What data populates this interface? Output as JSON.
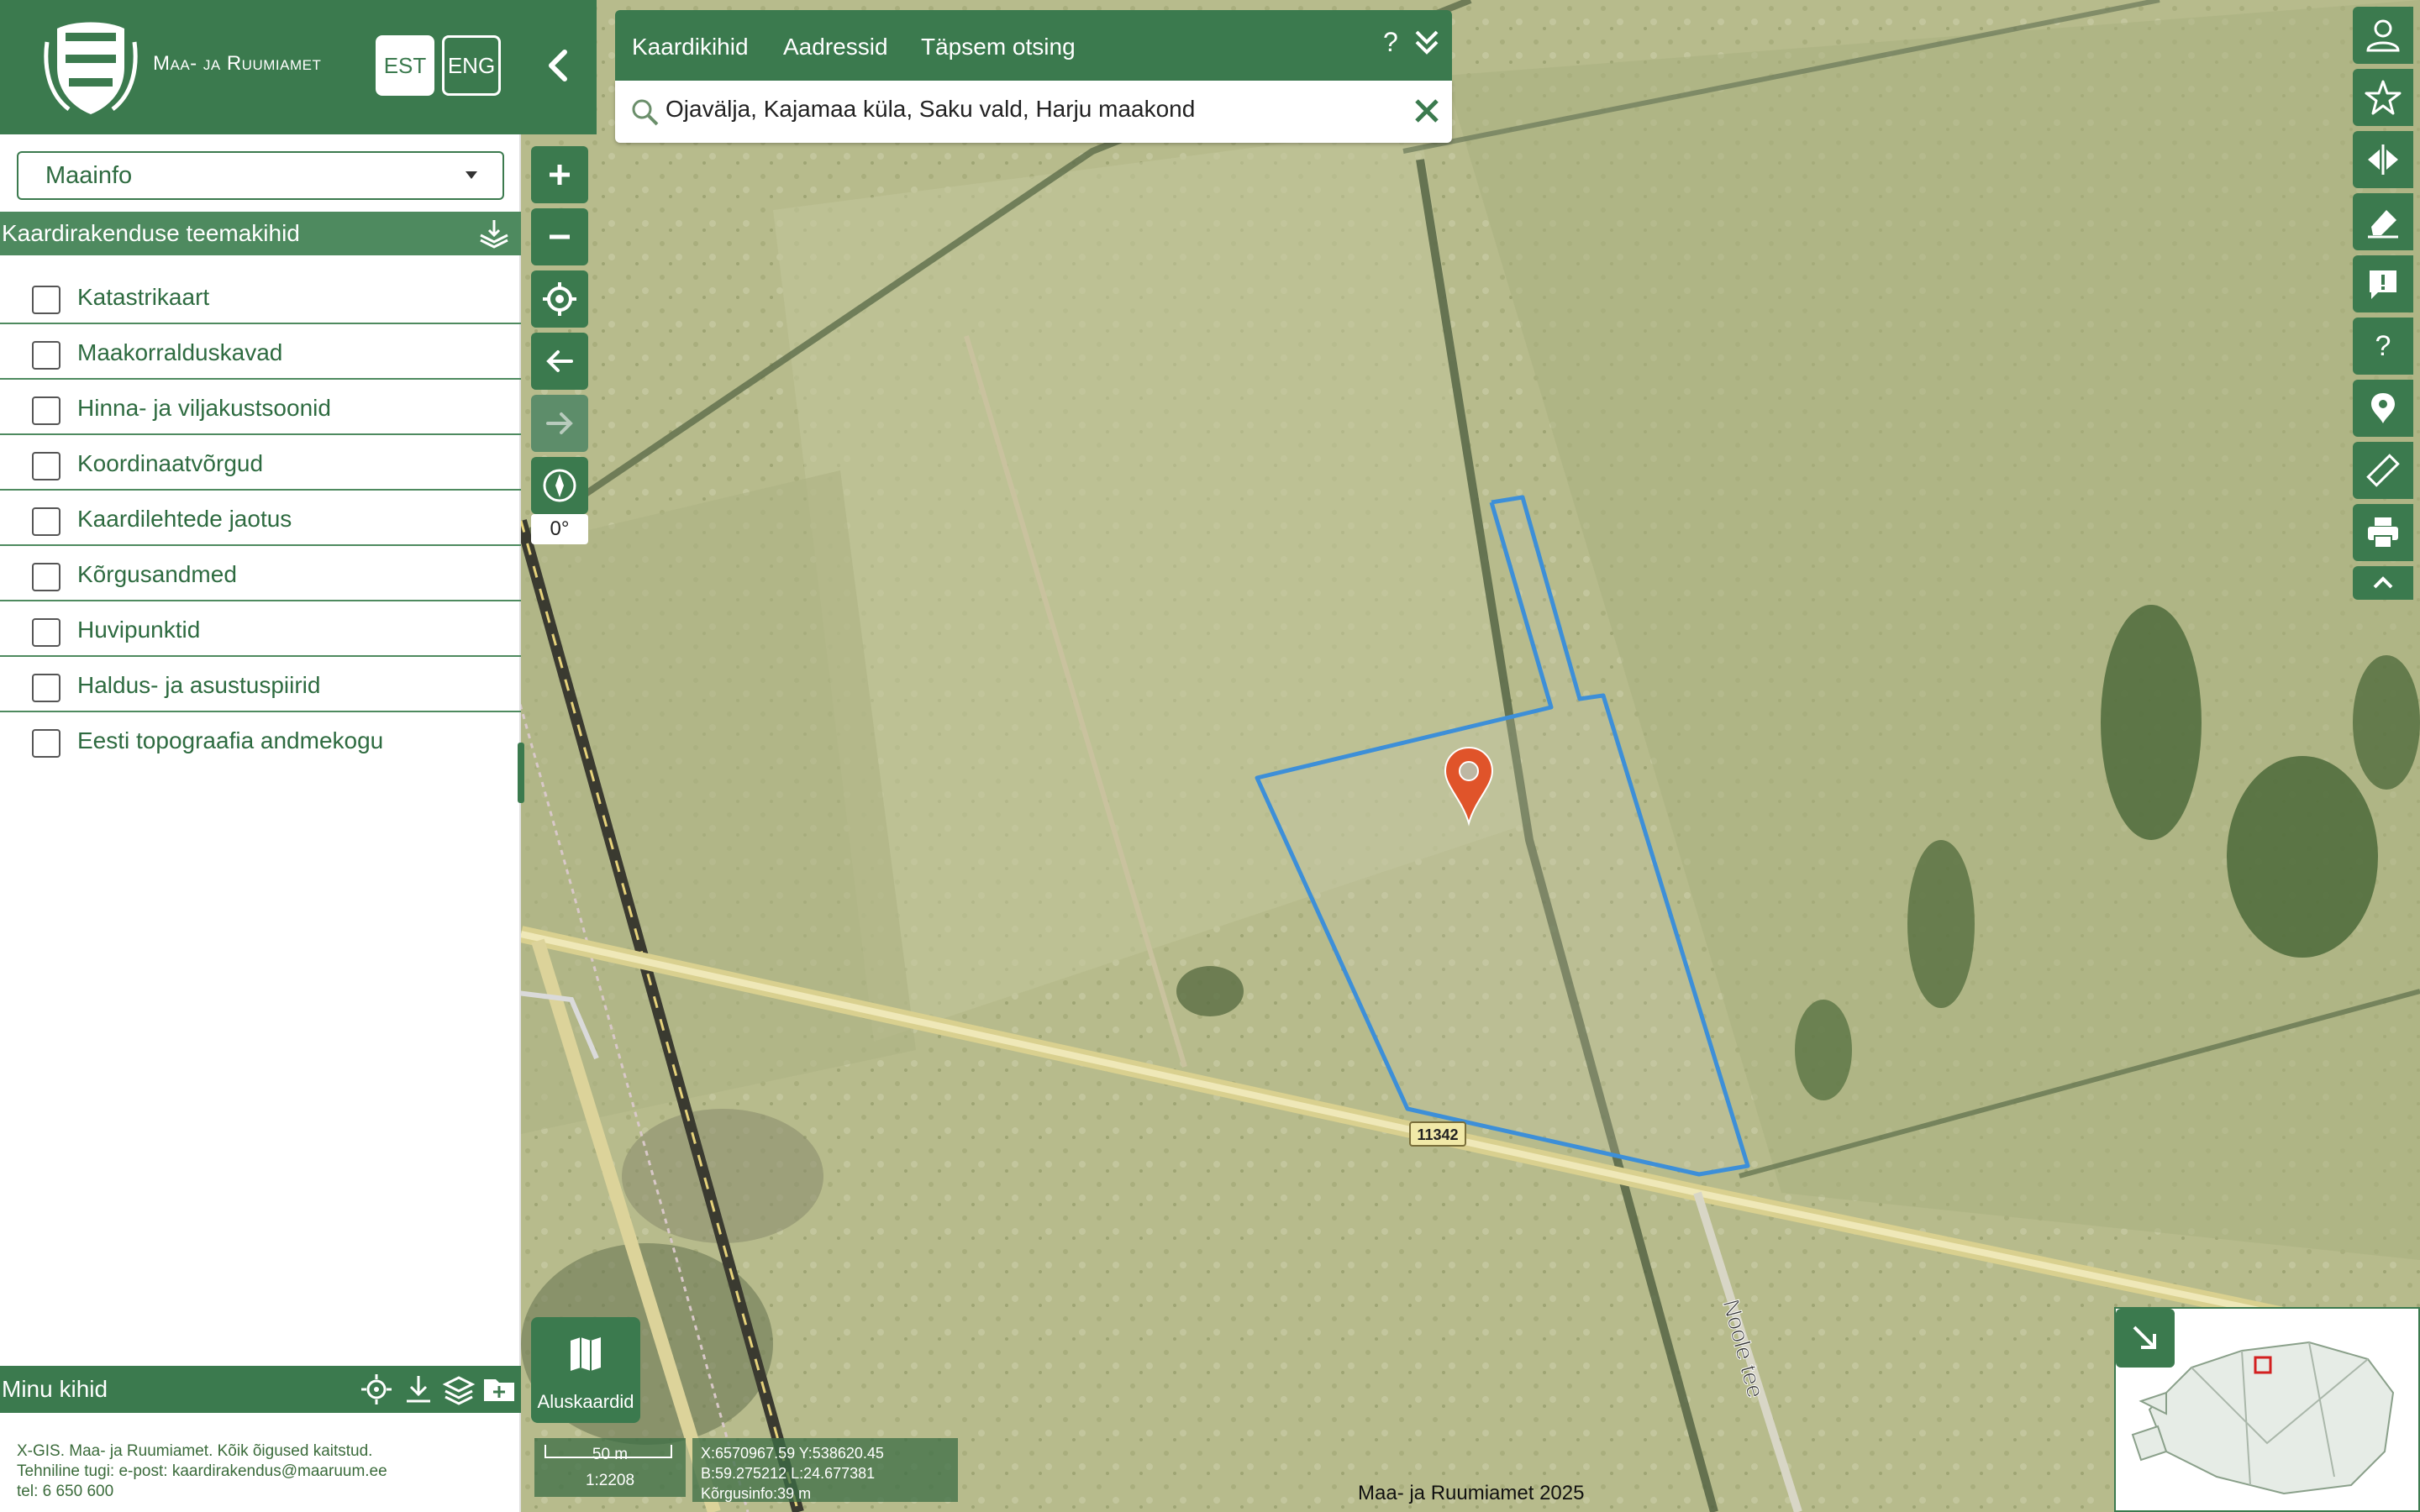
{
  "header": {
    "org_name": "Maa- ja Ruumiamet",
    "lang_est": "EST",
    "lang_eng": "ENG"
  },
  "app_select": {
    "value": "Maainfo"
  },
  "theme_layers": {
    "title": "Kaardirakenduse teemakihid",
    "items": [
      {
        "label": "Katastrikaart"
      },
      {
        "label": "Maakorralduskavad"
      },
      {
        "label": "Hinna- ja viljakustsoonid"
      },
      {
        "label": "Koordinaatvõrgud"
      },
      {
        "label": "Kaardilehtede jaotus"
      },
      {
        "label": "Kõrgusandmed"
      },
      {
        "label": "Huvipunktid"
      },
      {
        "label": "Haldus- ja asustuspiirid"
      },
      {
        "label": "Eesti topograafia andmekogu"
      }
    ]
  },
  "my_layers": {
    "title": "Minu kihid"
  },
  "footer": {
    "line1": "X-GIS. Maa- ja Ruumiamet. Kõik õigused kaitstud.",
    "line2": "Tehniline tugi: e-post: kaardirakendus@maaruum.ee",
    "line3": "tel: 6 650 600"
  },
  "search": {
    "tabs": [
      "Kaardikihid",
      "Aadressid",
      "Täpsem otsing"
    ],
    "help_label": "?",
    "value": "Ojavälja, Kajamaa küla, Saku vald, Harju maakond"
  },
  "map": {
    "rotation": "0°",
    "basemaps_label": "Aluskaardid",
    "scale_distance": "50 m",
    "scale_ratio": "1:2208",
    "coord_xy": "X:6570967.59 Y:538620.45",
    "coord_bl": "B:59.275212 L:24.677381",
    "elevation": "Kõrgusinfo:39 m",
    "attribution": "Maa- ja Ruumiamet 2025",
    "road_number": "11342",
    "road_name": "Noole tee"
  },
  "colors": {
    "brand_green": "#3b7a4e",
    "parcel_outline": "#3d8fd8",
    "marker": "#e0542a"
  }
}
